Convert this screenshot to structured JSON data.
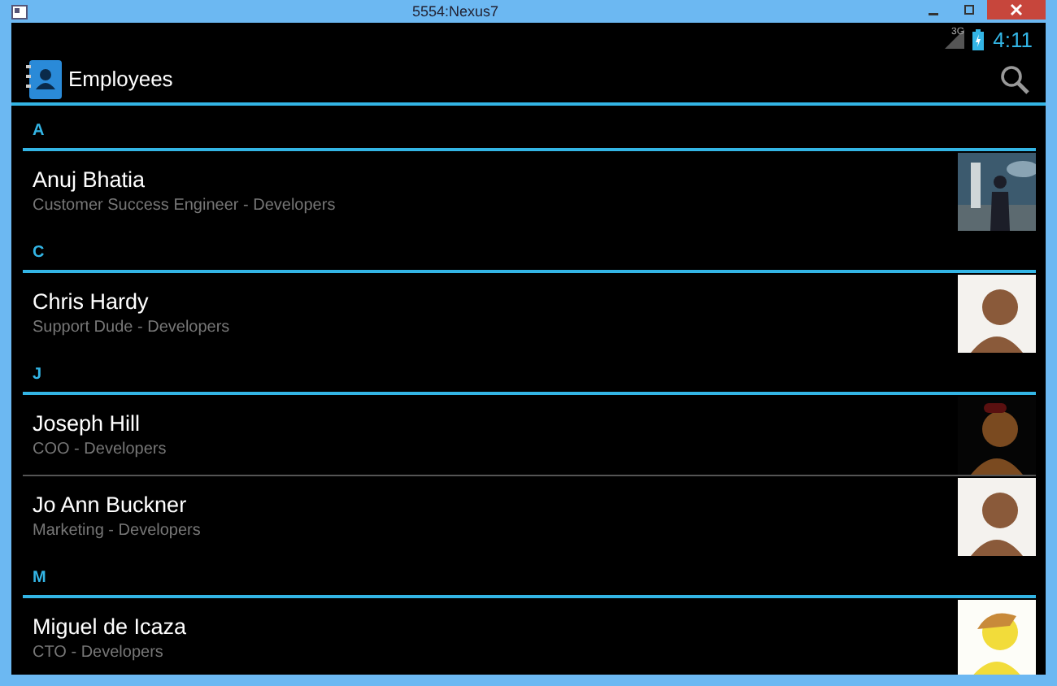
{
  "window": {
    "title": "5554:Nexus7"
  },
  "status_bar": {
    "network": "3G",
    "time": "4:11"
  },
  "action_bar": {
    "title": "Employees"
  },
  "sections": [
    {
      "letter": "A",
      "employees": [
        {
          "name": "Anuj Bhatia",
          "subtitle": "Customer Success Engineer - Developers"
        }
      ]
    },
    {
      "letter": "C",
      "employees": [
        {
          "name": "Chris Hardy",
          "subtitle": "Support Dude - Developers"
        }
      ]
    },
    {
      "letter": "J",
      "employees": [
        {
          "name": "Joseph Hill",
          "subtitle": "COO - Developers"
        },
        {
          "name": "Jo Ann Buckner",
          "subtitle": "Marketing - Developers"
        }
      ]
    },
    {
      "letter": "M",
      "employees": [
        {
          "name": "Miguel de Icaza",
          "subtitle": "CTO - Developers"
        }
      ]
    }
  ]
}
